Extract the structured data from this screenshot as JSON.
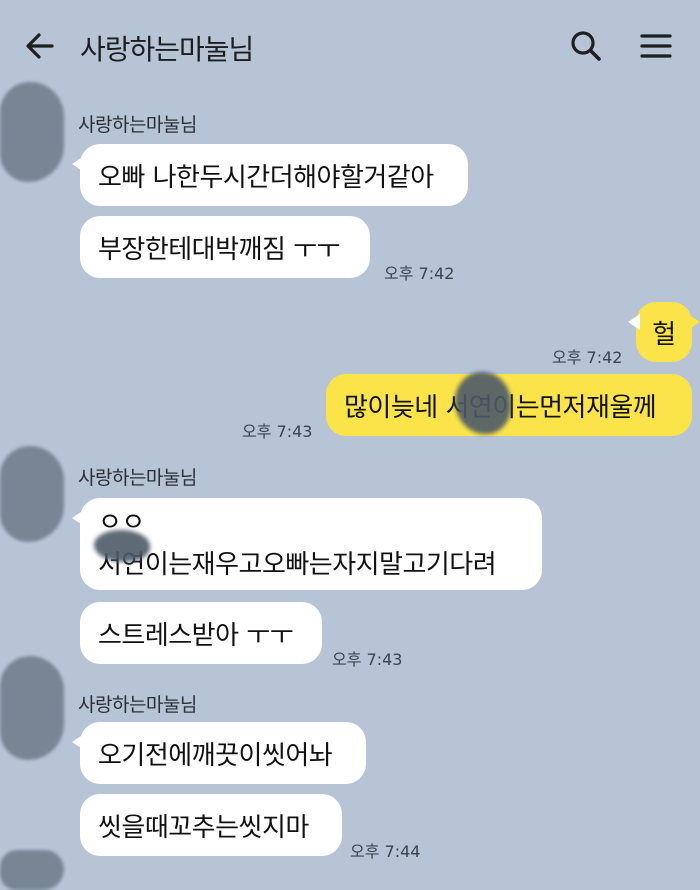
{
  "header": {
    "title": "사랑하는마눌님",
    "icons": [
      "back-arrow-icon",
      "search-icon",
      "menu-icon"
    ]
  },
  "messages": {
    "g1": {
      "sender": "사랑하는마눌님",
      "m1": "오빠 나한두시간더해야할거같아",
      "m2": "부장한테대박깨짐 ㅜㅜ",
      "time": "오후 7:42"
    },
    "me1": {
      "text": "헐",
      "time": "오후 7:42"
    },
    "me2": {
      "text": "많이늦네 서연이는먼저재울께",
      "time": "오후 7:43"
    },
    "g2": {
      "sender": "사랑하는마눌님",
      "m1_line1": "ㅇㅇ",
      "m1_line2": "서연이는재우고오빠는자지말고기다려",
      "m2": "스트레스받아 ㅜㅜ",
      "time": "오후 7:43"
    },
    "g3": {
      "sender": "사랑하는마눌님",
      "m1": "오기전에깨끗이씻어놔",
      "m2": "씻을때꼬추는씻지마",
      "time": "오후 7:44"
    }
  },
  "colors": {
    "background": "#b6c4d6",
    "my_bubble": "#fae44a",
    "their_bubble": "#ffffff"
  }
}
